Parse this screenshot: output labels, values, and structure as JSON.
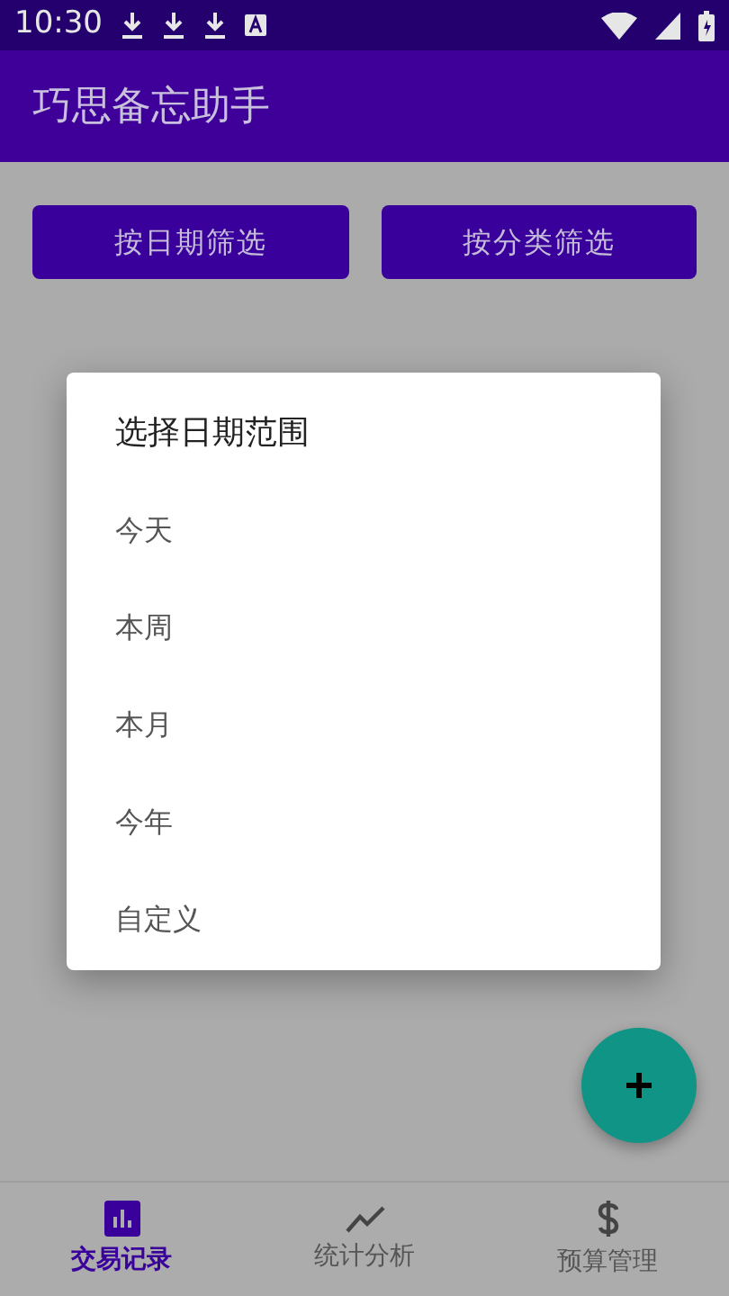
{
  "status_bar": {
    "time": "10:30"
  },
  "app_bar": {
    "title": "巧思备忘助手"
  },
  "filter_buttons": [
    "按日期筛选",
    "按分类筛选"
  ],
  "dialog": {
    "title": "选择日期范围",
    "options": [
      {
        "label": "今天"
      },
      {
        "label": "本周"
      },
      {
        "label": "本月"
      },
      {
        "label": "今年"
      },
      {
        "label": "自定义"
      }
    ]
  },
  "bottom_nav": [
    {
      "label": "交易记录",
      "kind": "records",
      "selected": true
    },
    {
      "label": "统计分析",
      "kind": "stats",
      "selected": false
    },
    {
      "label": "预算管理",
      "kind": "budget",
      "selected": false
    }
  ]
}
